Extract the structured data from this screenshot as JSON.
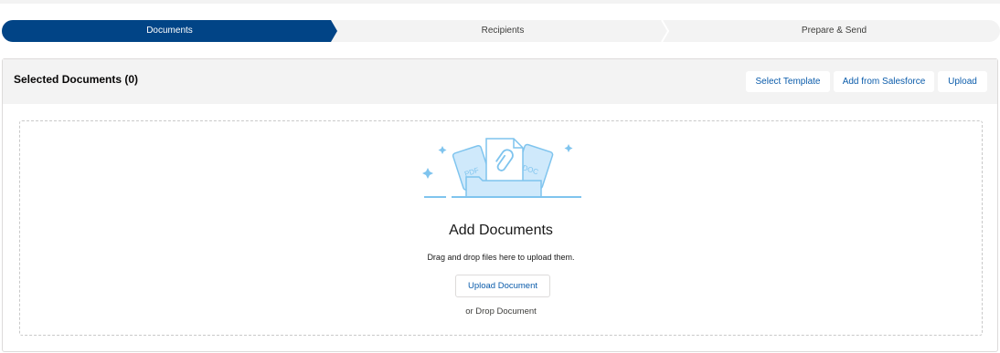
{
  "path": {
    "steps": [
      {
        "label": "Documents",
        "active": true
      },
      {
        "label": "Recipients",
        "active": false
      },
      {
        "label": "Prepare & Send",
        "active": false
      }
    ]
  },
  "card": {
    "title": "Selected Documents (0)",
    "buttons": {
      "select_template": "Select Template",
      "add_from_salesforce": "Add from Salesforce",
      "upload": "Upload"
    }
  },
  "dropzone": {
    "title": "Add Documents",
    "subtitle": "Drag and drop files here to upload them.",
    "upload_button": "Upload Document",
    "or_drop": "or Drop Document",
    "file_labels": {
      "pdf": "PDF",
      "doc": "DOC"
    }
  },
  "colors": {
    "active_step": "#014486",
    "inactive_step": "#f3f3f3",
    "link": "#0b5cab",
    "illustration_stroke": "#7fc4ee",
    "illustration_fill": "#cfe9fb"
  },
  "icons": [
    "paperclip-icon",
    "sparkle-icon",
    "folder-icon"
  ]
}
